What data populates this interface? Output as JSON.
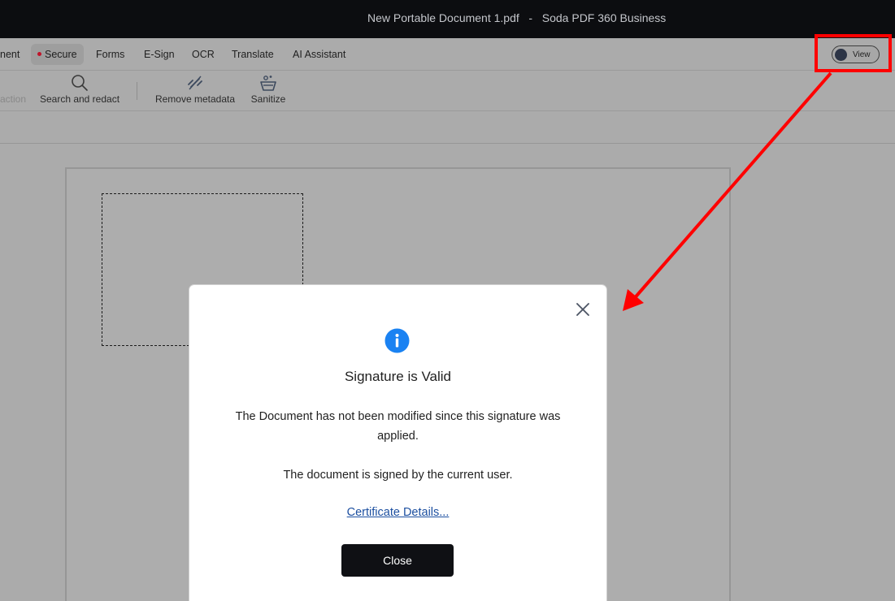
{
  "window": {
    "title": "New Portable Document 1.pdf   -   Soda PDF 360 Business"
  },
  "menu": {
    "items": [
      {
        "label": "nent",
        "active": false
      },
      {
        "label": "Secure",
        "active": true
      },
      {
        "label": "Forms",
        "active": false
      },
      {
        "label": "E-Sign",
        "active": false
      },
      {
        "label": "OCR",
        "active": false
      },
      {
        "label": "Translate",
        "active": false
      },
      {
        "label": "AI Assistant",
        "active": false
      }
    ],
    "view_toggle": "View"
  },
  "toolbar": {
    "faded_label": "action",
    "tools": [
      {
        "label": "Search and redact",
        "icon": "search-icon"
      },
      {
        "label": "Remove metadata",
        "icon": "remove-metadata-icon"
      },
      {
        "label": "Sanitize",
        "icon": "sanitize-icon"
      }
    ]
  },
  "dialog": {
    "icon": "info-icon",
    "title": "Signature is Valid",
    "message": "The Document has not been modified since this signature was applied.",
    "message2": "The document is signed by the current user.",
    "link": "Certificate Details...",
    "close_button": "Close"
  },
  "colors": {
    "annotation": "#ff0000",
    "info_blue": "#1a82f2",
    "link": "#1c4fa0",
    "button": "#0f1014",
    "active_dot": "#c0142a"
  }
}
